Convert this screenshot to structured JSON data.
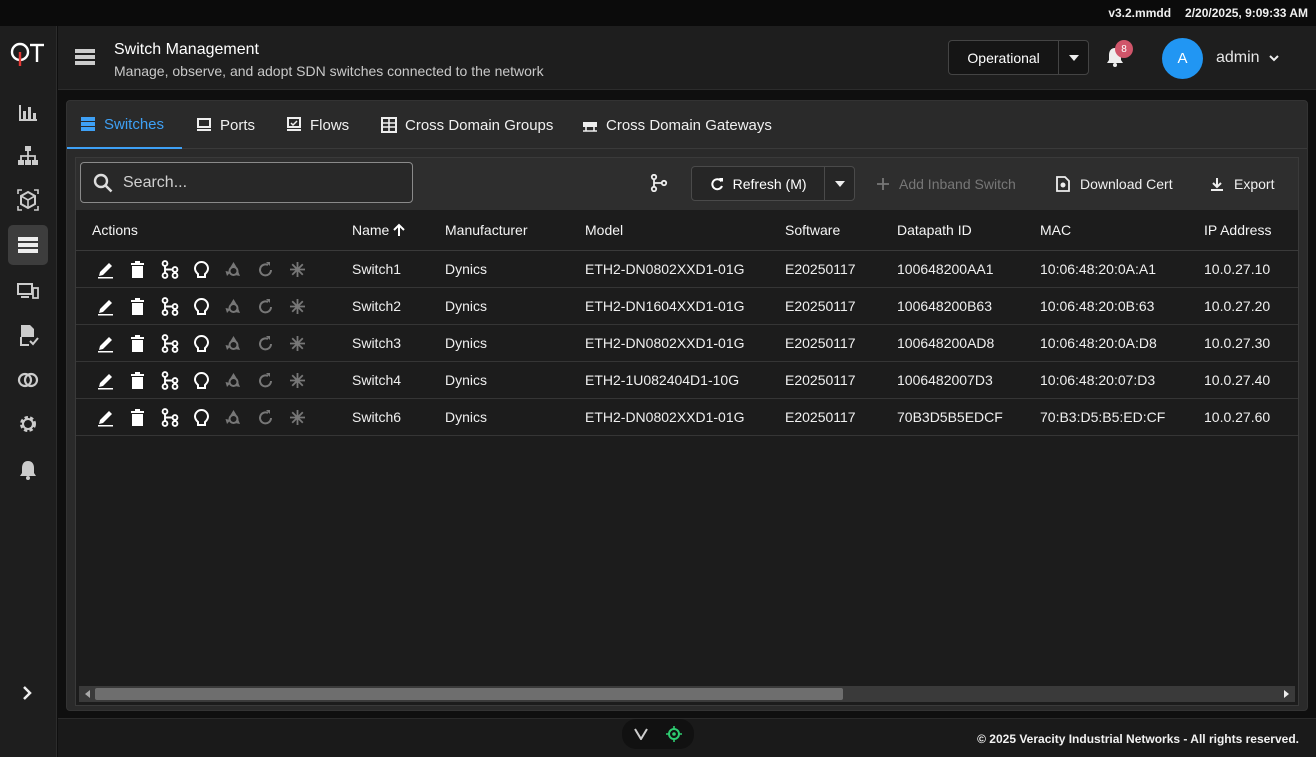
{
  "topbar": {
    "version": "v3.2.mmdd",
    "datetime": "2/20/2025, 9:09:33 AM"
  },
  "sidebar": {
    "logo": "QT",
    "items": [
      {
        "name": "analytics-icon"
      },
      {
        "name": "topology-icon"
      },
      {
        "name": "cube-icon"
      },
      {
        "name": "switch-list-icon",
        "active": true
      },
      {
        "name": "devices-icon"
      },
      {
        "name": "document-check-icon"
      },
      {
        "name": "domains-icon"
      },
      {
        "name": "gear-icon"
      },
      {
        "name": "bell-icon"
      }
    ]
  },
  "header": {
    "title": "Switch Management",
    "subtitle": "Manage, observe, and adopt SDN switches connected to the network",
    "mode": "Operational",
    "notifications": "8",
    "avatar": "A",
    "user": "admin"
  },
  "tabs": [
    {
      "label": "Switches",
      "icon": "switches-icon",
      "active": true
    },
    {
      "label": "Ports",
      "icon": "ports-icon"
    },
    {
      "label": "Flows",
      "icon": "flows-icon"
    },
    {
      "label": "Cross Domain Groups",
      "icon": "grid-icon"
    },
    {
      "label": "Cross Domain Gateways",
      "icon": "gateway-icon"
    }
  ],
  "toolbar": {
    "search_placeholder": "Search...",
    "refresh": "Refresh (M)",
    "add_inband": "Add Inband Switch",
    "download_cert": "Download Cert",
    "export": "Export"
  },
  "table": {
    "columns": [
      "Actions",
      "Name",
      "Manufacturer",
      "Model",
      "Software",
      "Datapath ID",
      "MAC",
      "IP Address"
    ],
    "rows": [
      {
        "name": "Switch1",
        "manufacturer": "Dynics",
        "model": "ETH2-DN0802XXD1-01G",
        "software": "E20250117",
        "dpid": "100648200AA1",
        "mac": "10:06:48:20:0A:A1",
        "ip": "10.0.27.10"
      },
      {
        "name": "Switch2",
        "manufacturer": "Dynics",
        "model": "ETH2-DN1604XXD1-01G",
        "software": "E20250117",
        "dpid": "100648200B63",
        "mac": "10:06:48:20:0B:63",
        "ip": "10.0.27.20"
      },
      {
        "name": "Switch3",
        "manufacturer": "Dynics",
        "model": "ETH2-DN0802XXD1-01G",
        "software": "E20250117",
        "dpid": "100648200AD8",
        "mac": "10:06:48:20:0A:D8",
        "ip": "10.0.27.30"
      },
      {
        "name": "Switch4",
        "manufacturer": "Dynics",
        "model": "ETH2-1U082404D1-10G",
        "software": "E20250117",
        "dpid": "1006482007D3",
        "mac": "10:06:48:20:07:D3",
        "ip": "10.0.27.40"
      },
      {
        "name": "Switch6",
        "manufacturer": "Dynics",
        "model": "ETH2-DN0802XXD1-01G",
        "software": "E20250117",
        "dpid": "70B3D5B5EDCF",
        "mac": "70:B3:D5:B5:ED:CF",
        "ip": "10.0.27.60"
      }
    ]
  },
  "footer": {
    "copyright": "© 2025 Veracity Industrial Networks - All rights reserved."
  },
  "colors": {
    "accent": "#3ea0f5",
    "badge": "#d0556a",
    "avatar": "#2196f3",
    "pill_icon": "#2ecc71"
  }
}
